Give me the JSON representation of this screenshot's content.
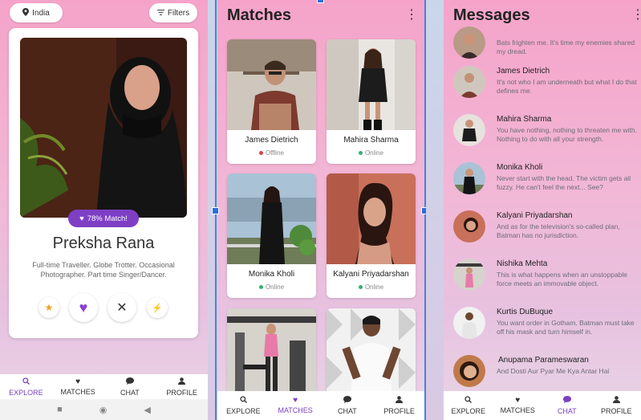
{
  "explore": {
    "location_chip": "India",
    "filters_chip": "Filters",
    "match_badge": "78% Match!",
    "name": "Preksha Rana",
    "bio": "Full-time Traveller. Globe Trotter. Occasional Photographer. Part time Singer/Dancer.",
    "actions": [
      "star-icon",
      "heart-icon",
      "close-icon",
      "bolt-icon"
    ]
  },
  "nav": {
    "explore": "EXPLORE",
    "matches": "MATCHES",
    "chat": "CHAT",
    "profile": "PROFILE"
  },
  "matches": {
    "title": "Matches",
    "cards": [
      {
        "name": "James Dietrich",
        "status": "Offline"
      },
      {
        "name": "Mahira Sharma",
        "status": "Online"
      },
      {
        "name": "Monika Kholi",
        "status": "Online"
      },
      {
        "name": "Kalyani Priyadarshan",
        "status": "Online"
      },
      {
        "name": "",
        "status": ""
      },
      {
        "name": "",
        "status": ""
      }
    ]
  },
  "messages": {
    "title": "Messages",
    "items": [
      {
        "name": "",
        "text": "Bats frighten me. It's time my enemies shared my dread."
      },
      {
        "name": "James Dietrich",
        "text": "It's not who I am underneath but what I do that defines me."
      },
      {
        "name": "Mahira Sharma",
        "text": "You have nothing, nothing to threaten me with. Nothing to do with all your strength."
      },
      {
        "name": "Monika Kholi",
        "text": "Never start with the head. The victim gets all fuzzy. He can't feel the next... See?"
      },
      {
        "name": "Kalyani Priyadarshan",
        "text": "And as for the television's so-called plan, Batman has no jurisdiction."
      },
      {
        "name": "Nishika Mehta",
        "text": "This is what happens when an unstoppable force meets an immovable object."
      },
      {
        "name": "Kurtis DuBuque",
        "text": "You want order in Gotham. Batman must take off his mask and turn himself in."
      },
      {
        "name": "Anupama Parameswaran",
        "text": "And Dosti Aur Pyar Me Kya Antar Hai"
      }
    ]
  },
  "colors": {
    "accent": "#7b3fc4",
    "online": "#2fb36e",
    "offline": "#e0404a",
    "selection": "#2a6fdc"
  }
}
